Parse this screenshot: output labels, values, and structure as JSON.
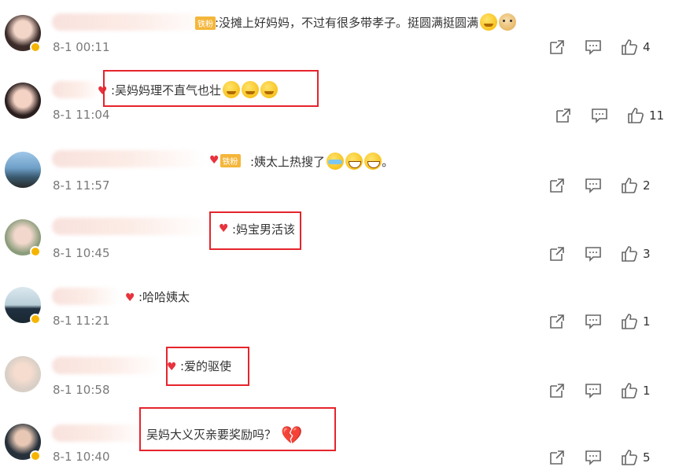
{
  "comments": [
    {
      "text": ":没摊上好妈妈，不过有很多带孝子。挺圆满挺圆满",
      "time": "8-1 00:11",
      "likes": "4",
      "fan_badge": "铁粉",
      "emojis": [
        "smile-icon",
        "dog-icon"
      ]
    },
    {
      "text": ":吴妈妈理不直气也壮",
      "time": "8-1 11:04",
      "likes": "11",
      "fan_badge": "",
      "emojis": [
        "smile-icon",
        "smile-icon",
        "smile-icon"
      ]
    },
    {
      "text": ":姨太上热搜了",
      "time": "8-1 11:57",
      "likes": "2",
      "fan_badge": "铁粉",
      "emojis": [
        "cry-laugh-icon",
        "laugh-icon",
        "laugh-icon"
      ],
      "suffix": "。"
    },
    {
      "text": ":妈宝男活该",
      "time": "8-1 10:45",
      "likes": "3",
      "fan_badge": "",
      "emojis": []
    },
    {
      "text": ":哈哈姨太",
      "time": "8-1 11:21",
      "likes": "1",
      "fan_badge": "",
      "emojis": []
    },
    {
      "text": ":爱的驱使",
      "time": "8-1 10:58",
      "likes": "1",
      "fan_badge": "",
      "emojis": []
    },
    {
      "text": "吴妈大义灭亲要奖励吗？",
      "time": "8-1 10:40",
      "likes": "5",
      "fan_badge": "",
      "emojis": [
        "broken-heart-icon"
      ]
    }
  ],
  "colors": {
    "highlight_box": "#e6242c",
    "badge": "#f4b63a",
    "time_text": "#7a7a7a"
  }
}
